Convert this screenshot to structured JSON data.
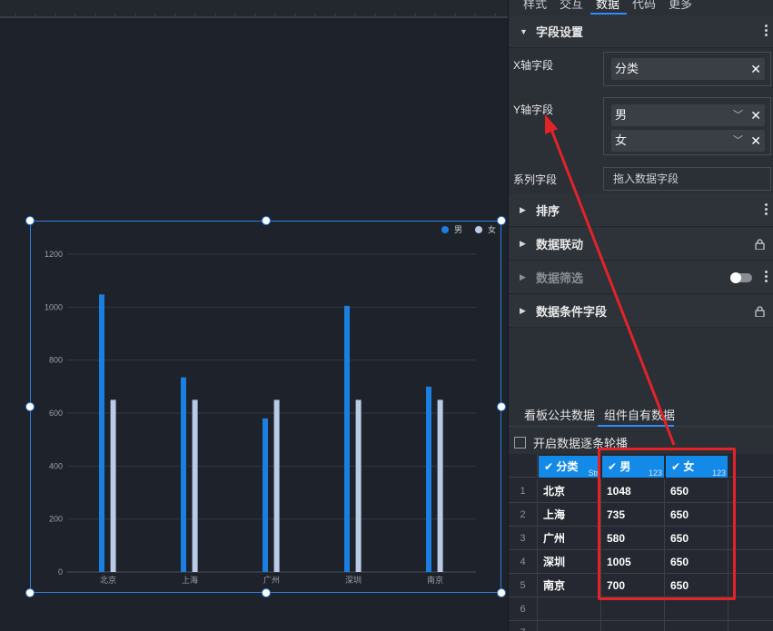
{
  "panel": {
    "tabs": [
      "样式",
      "交互",
      "数据",
      "代码",
      "更多"
    ],
    "active_tab": "数据",
    "sections": {
      "field_settings": "字段设置",
      "sort": "排序",
      "data_linkage": "数据联动",
      "data_filter": "数据筛选",
      "data_condition_field": "数据条件字段"
    },
    "x_axis_label": "X轴字段",
    "x_axis_value": "分类",
    "y_axis_label": "Y轴字段",
    "y_axis_values": [
      "男",
      "女"
    ],
    "series_label": "系列字段",
    "series_placeholder": "拖入数据字段",
    "subtabs": [
      "看板公共数据",
      "组件自有数据"
    ],
    "carousel_label": "开启数据逐条轮播"
  },
  "table": {
    "headers": [
      {
        "name": "分类",
        "type": "Str"
      },
      {
        "name": "男",
        "type": "123"
      },
      {
        "name": "女",
        "type": "123"
      }
    ],
    "rows": [
      [
        "北京",
        "1048",
        "650"
      ],
      [
        "上海",
        "735",
        "650"
      ],
      [
        "广州",
        "580",
        "650"
      ],
      [
        "深圳",
        "1005",
        "650"
      ],
      [
        "南京",
        "700",
        "650"
      ]
    ],
    "row_numbers": [
      "1",
      "2",
      "3",
      "4",
      "5",
      "6",
      "7"
    ]
  },
  "chart_data": {
    "type": "bar",
    "categories": [
      "北京",
      "上海",
      "广州",
      "深圳",
      "南京"
    ],
    "series": [
      {
        "name": "男",
        "values": [
          1048,
          735,
          580,
          1005,
          700
        ],
        "color": "#1a7fe0"
      },
      {
        "name": "女",
        "values": [
          650,
          650,
          650,
          650,
          650
        ],
        "color": "#b9cbe6"
      }
    ],
    "ylim": [
      0,
      1200
    ],
    "yticks": [
      "0",
      "200",
      "400",
      "600",
      "800",
      "1000",
      "1200"
    ],
    "grid": true,
    "legend": "top-right"
  },
  "colors": {
    "accent": "#1389e8",
    "highlight": "#e3232a"
  }
}
